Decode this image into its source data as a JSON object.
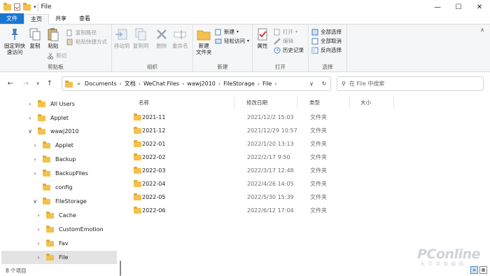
{
  "window": {
    "title": "File",
    "minimize": "—",
    "maximize": "☐",
    "close": "✕"
  },
  "ribbon_tabs": [
    "文件",
    "主页",
    "共享",
    "查看"
  ],
  "ribbon": {
    "clipboard": {
      "label": "剪贴板",
      "pin_quick_access": "固定到快速访问",
      "copy": "复制",
      "paste": "粘贴",
      "copy_path": "复制路径",
      "paste_shortcut": "粘贴快捷方式",
      "cut": "剪切"
    },
    "organize": {
      "label": "组织",
      "move_to": "移动到",
      "copy_to": "复制到",
      "delete": "删除",
      "rename": "重命名"
    },
    "new": {
      "label": "新建",
      "new_folder": "新建\n文件夹",
      "new_item": "新建",
      "easy_access": "轻松访问"
    },
    "open": {
      "label": "打开",
      "properties": "属性",
      "open": "打开",
      "edit": "编辑",
      "history": "历史记录"
    },
    "select": {
      "label": "选择",
      "select_all": "全部选择",
      "select_none": "全部取消",
      "invert": "反向选择"
    }
  },
  "nav": {
    "back": "←",
    "forward": "→",
    "recent": "∨",
    "up": "↑"
  },
  "address": {
    "prefix": "«",
    "crumbs": [
      "Documents",
      "文档",
      "WeChat Files",
      "wawj2010",
      "FileStorage",
      "File"
    ],
    "dropdown": "∨",
    "refresh": "↻"
  },
  "search": {
    "placeholder": "在 File 中搜索"
  },
  "tree": [
    {
      "label": "All Users",
      "chev": "›"
    },
    {
      "label": "Applet",
      "chev": "›"
    },
    {
      "label": "wawj2010",
      "chev": "∨"
    },
    {
      "label": "Applet",
      "chev": "›"
    },
    {
      "label": "Backup",
      "chev": "›"
    },
    {
      "label": "BackupFiles",
      "chev": "›"
    },
    {
      "label": "config",
      "chev": ""
    },
    {
      "label": "FileStorage",
      "chev": "∨"
    },
    {
      "label": "Cache",
      "chev": "›"
    },
    {
      "label": "CustomEmotion",
      "chev": "›"
    },
    {
      "label": "Fav",
      "chev": "›"
    },
    {
      "label": "File",
      "chev": "›"
    }
  ],
  "columns": [
    "名称",
    "修改日期",
    "类型",
    "大小"
  ],
  "files": [
    {
      "name": "2021-11",
      "date": "2021/12/2 15:03",
      "type": "文件夹"
    },
    {
      "name": "2021-12",
      "date": "2021/12/29 10:57",
      "type": "文件夹"
    },
    {
      "name": "2022-01",
      "date": "2022/1/20 13:13",
      "type": "文件夹"
    },
    {
      "name": "2022-02",
      "date": "2022/2/17 9:50",
      "type": "文件夹"
    },
    {
      "name": "2022-03",
      "date": "2022/3/17 12:48",
      "type": "文件夹"
    },
    {
      "name": "2022-04",
      "date": "2022/4/26 14:05",
      "type": "文件夹"
    },
    {
      "name": "2022-05",
      "date": "2022/5/30 15:39",
      "type": "文件夹"
    },
    {
      "name": "2022-06",
      "date": "2022/6/12 17:04",
      "type": "文件夹"
    }
  ],
  "status": {
    "item_count": "8 个项目"
  },
  "watermark": {
    "brand": "PConline",
    "sub": "太平洋电脑网"
  },
  "colors": {
    "accent": "#1976d2",
    "folder": "#f2c14e"
  }
}
